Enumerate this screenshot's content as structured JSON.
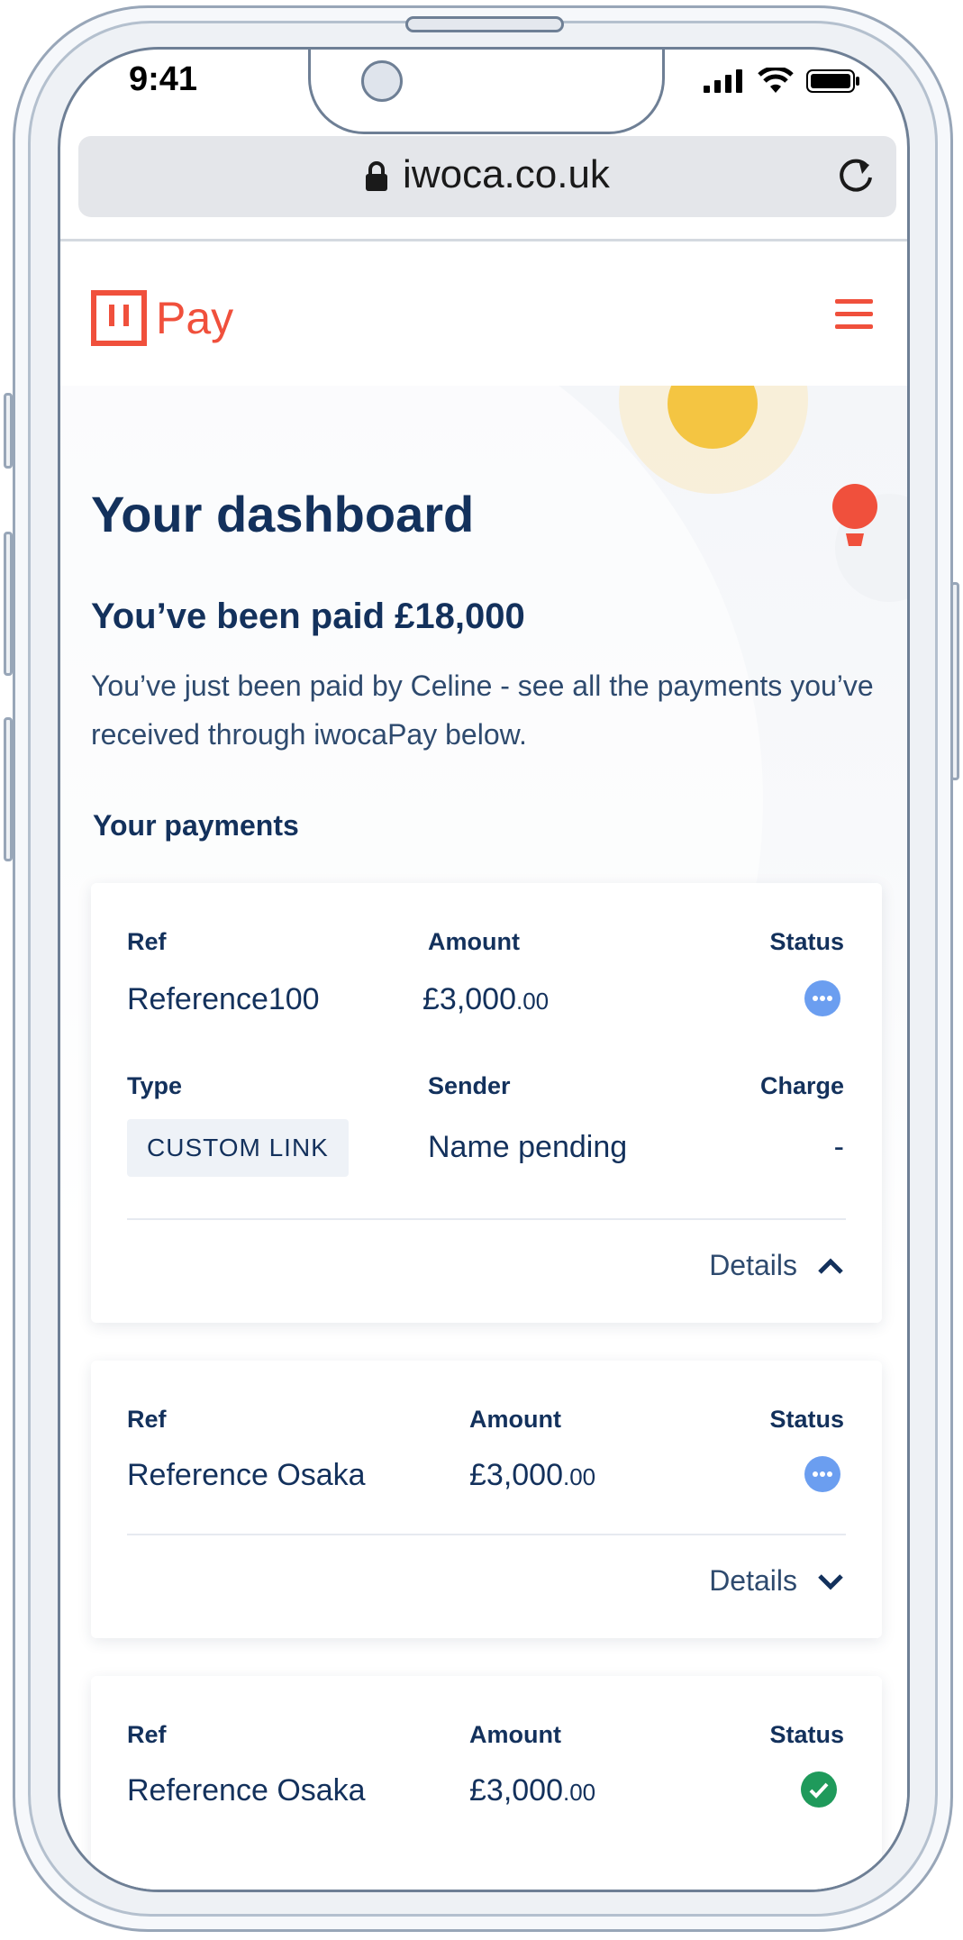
{
  "status_bar": {
    "time": "9:41"
  },
  "browser": {
    "url": "iwoca.co.uk"
  },
  "header": {
    "logo_text": "Pay"
  },
  "hero": {
    "title": "Your dashboard",
    "subtitle": "You’ve been paid £18,000",
    "lead": "You’ve just been paid by Celine - see all the payments you’ve received through iwocaPay below."
  },
  "payments": {
    "section_title": "Your payments",
    "labels": {
      "ref": "Ref",
      "amount": "Amount",
      "status": "Status",
      "type": "Type",
      "sender": "Sender",
      "charge": "Charge",
      "details": "Details"
    },
    "items": [
      {
        "ref": "Reference100",
        "amount_main": "£3,000",
        "amount_pence": ".00",
        "status": "pending",
        "expanded": true,
        "type": "CUSTOM LINK",
        "sender": "Name pending",
        "charge": "-"
      },
      {
        "ref": "Reference Osaka",
        "amount_main": "£3,000",
        "amount_pence": ".00",
        "status": "pending",
        "expanded": false
      },
      {
        "ref": "Reference Osaka",
        "amount_main": "£3,000",
        "amount_pence": ".00",
        "status": "complete",
        "expanded": false
      }
    ]
  },
  "colors": {
    "brand": "#f0503c",
    "navy": "#13315c",
    "pending": "#6b9ef0",
    "complete": "#1f9a5b",
    "sun": "#f4c542"
  }
}
